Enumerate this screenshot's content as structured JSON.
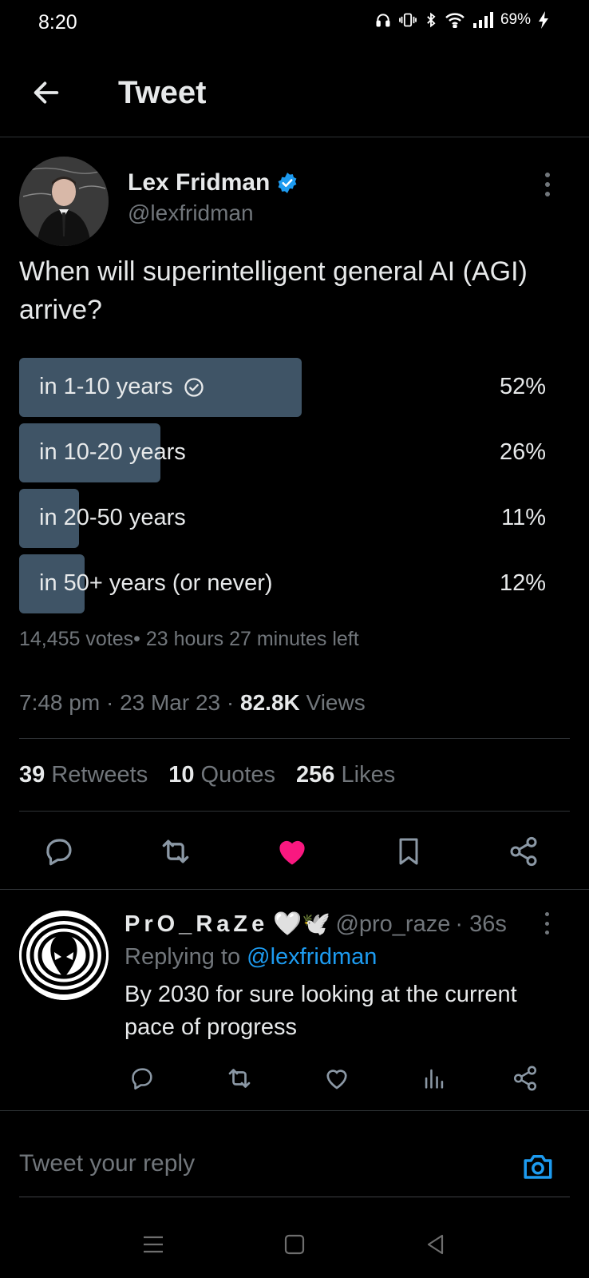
{
  "status_bar": {
    "time": "8:20",
    "battery": "69%",
    "icons": [
      "headphones-icon",
      "vibrate-icon",
      "bluetooth-icon",
      "wifi-icon",
      "signal-icon",
      "battery-charging-icon"
    ]
  },
  "header": {
    "title": "Tweet"
  },
  "tweet": {
    "author_name": "Lex Fridman",
    "author_handle": "@lexfridman",
    "verified": true,
    "text": "When will superintelligent general AI (AGI) arrive?",
    "poll": {
      "options": [
        {
          "label": "in 1-10 years",
          "percent_label": "52%",
          "percent": 52,
          "winner": true
        },
        {
          "label": "in 10-20 years",
          "percent_label": "26%",
          "percent": 26,
          "winner": false
        },
        {
          "label": "in 20-50 years",
          "percent_label": "11%",
          "percent": 11,
          "winner": false
        },
        {
          "label": "in 50+ years (or never)",
          "percent_label": "12%",
          "percent": 12,
          "winner": false
        }
      ],
      "meta": "14,455 votes• 23 hours 27 minutes left"
    },
    "time": "7:48 pm",
    "date": "23 Mar 23",
    "views_count": "82.8K",
    "views_label": "Views",
    "retweets_count": "39",
    "retweets_label": "Retweets",
    "quotes_count": "10",
    "quotes_label": "Quotes",
    "likes_count": "256",
    "likes_label": "Likes",
    "liked": true
  },
  "reply": {
    "name": "PrO_RaZe",
    "name_emojis": "🤍🕊️",
    "handle": "@pro_raze",
    "time": "· 36s",
    "replying_prefix": "Replying to",
    "replying_to": "@lexfridman",
    "text": "By 2030 for sure looking at the current pace of progress"
  },
  "composer": {
    "placeholder": "Tweet your reply"
  },
  "colors": {
    "background": "#000000",
    "text": "#e7e9ea",
    "muted": "#71767b",
    "accent": "#1d9bf0",
    "like": "#f91880",
    "poll_bar": "#3f5466"
  }
}
